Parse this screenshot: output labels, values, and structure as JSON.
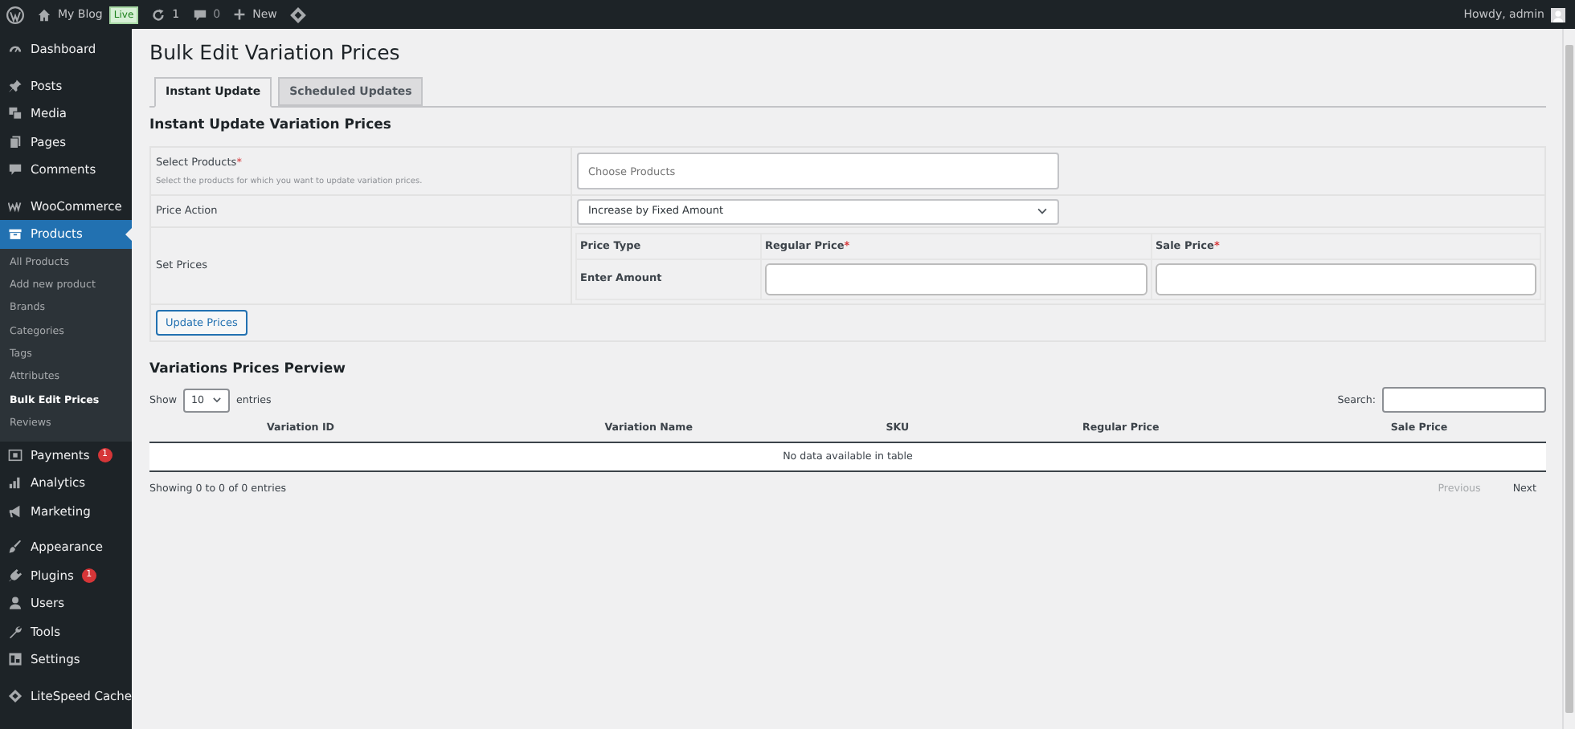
{
  "admin_bar": {
    "site": "My Blog",
    "live_badge": "Live",
    "updates": "1",
    "comments": "0",
    "new": "New",
    "greeting": "Howdy, admin"
  },
  "sidebar": {
    "groups": [
      {
        "items": [
          {
            "label": "Dashboard",
            "selected": false
          }
        ]
      },
      {
        "items": [
          {
            "label": "Posts",
            "selected": false
          },
          {
            "label": "Media",
            "selected": false
          },
          {
            "label": "Pages",
            "selected": false
          },
          {
            "label": "Comments",
            "selected": false
          }
        ]
      },
      {
        "items": [
          {
            "label": "WooCommerce",
            "selected": false
          },
          {
            "label": "Products",
            "selected": true,
            "children": [
              {
                "label": "All Products",
                "selected": false
              },
              {
                "label": "Add new product",
                "selected": false
              },
              {
                "label": "Brands",
                "selected": false
              },
              {
                "label": "Categories",
                "selected": false
              },
              {
                "label": "Tags",
                "selected": false
              },
              {
                "label": "Attributes",
                "selected": false
              },
              {
                "label": "Bulk Edit Prices",
                "selected": true
              },
              {
                "label": "Reviews",
                "selected": false
              }
            ]
          },
          {
            "label": "Payments",
            "selected": false,
            "badge": "1"
          },
          {
            "label": "Analytics",
            "selected": false
          },
          {
            "label": "Marketing",
            "selected": false
          }
        ]
      },
      {
        "items": [
          {
            "label": "Appearance",
            "selected": false
          },
          {
            "label": "Plugins",
            "selected": false,
            "badge": "1"
          },
          {
            "label": "Users",
            "selected": false
          },
          {
            "label": "Tools",
            "selected": false
          },
          {
            "label": "Settings",
            "selected": false
          }
        ]
      },
      {
        "items": [
          {
            "label": "LiteSpeed Cache",
            "selected": false
          }
        ]
      }
    ]
  },
  "page": {
    "title": "Bulk Edit Variation Prices",
    "tabs": [
      {
        "label": "Instant Update",
        "selected": true
      },
      {
        "label": "Scheduled Updates",
        "selected": false
      }
    ],
    "section_title": "Instant Update Variation Prices",
    "form": {
      "select_products": {
        "label": "Select Products",
        "required_mark": "*",
        "hint": "Select the products for which you want to update variation prices.",
        "placeholder": "Choose Products"
      },
      "price_action": {
        "label": "Price Action",
        "value": "Increase by Fixed Amount"
      },
      "set_prices": {
        "label": "Set Prices",
        "columns": [
          {
            "label": "Price Type"
          },
          {
            "label": "Regular Price",
            "required_mark": "*"
          },
          {
            "label": "Sale Price",
            "required_mark": "*"
          }
        ],
        "row_label": "Enter Amount"
      },
      "submit": "Update Prices"
    },
    "preview": {
      "title": "Variations Prices Perview",
      "show_label": "Show",
      "page_size": "10",
      "entries_label": "entries",
      "search_label": "Search:",
      "columns": [
        "Variation ID",
        "Variation Name",
        "SKU",
        "Regular Price",
        "Sale Price"
      ],
      "empty_message": "No data available in table",
      "info": "Showing 0 to 0 of 0 entries",
      "pagination": [
        {
          "label": "Previous",
          "disabled": true
        },
        {
          "label": "Next",
          "disabled": false
        }
      ]
    }
  }
}
